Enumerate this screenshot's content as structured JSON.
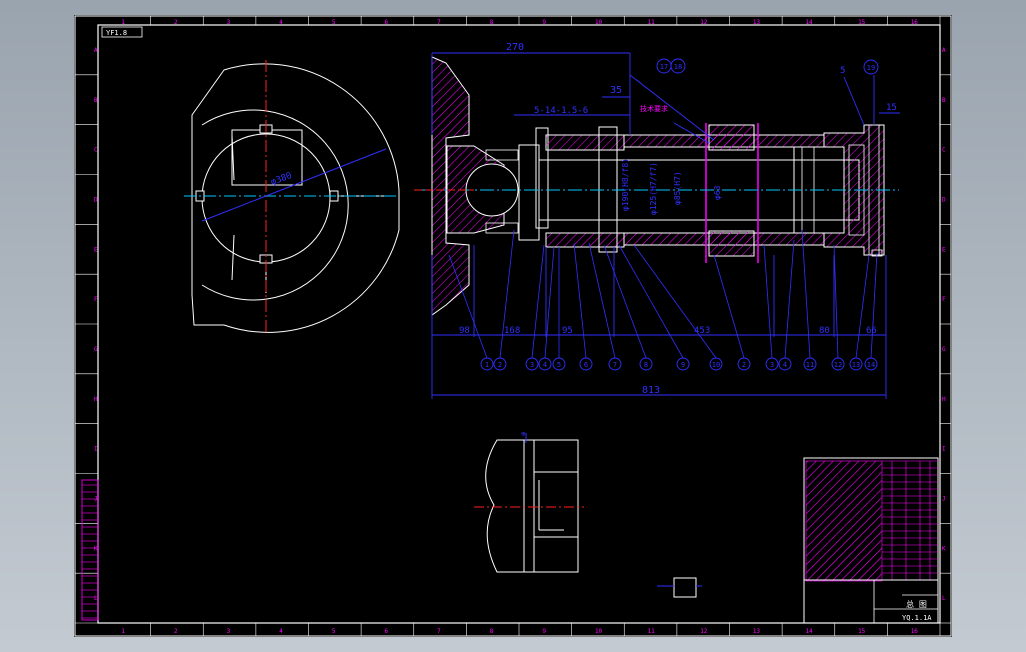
{
  "drawing": {
    "stamp": "YF1.8",
    "drawing_no": "YQ.1.1A",
    "part_title": "总 图",
    "column_labels": [
      "1",
      "2",
      "3",
      "4",
      "5",
      "6",
      "7",
      "8",
      "9",
      "10",
      "11",
      "12",
      "13",
      "14",
      "15",
      "16"
    ],
    "row_labels": [
      "A",
      "B",
      "C",
      "D",
      "E",
      "F",
      "G",
      "H",
      "I",
      "J",
      "K",
      "L"
    ],
    "dimensions": {
      "top_overall": "270",
      "top_step": "35",
      "thread_note": "5-14-1.5-6",
      "bore_circle": "φ380",
      "overall_length": "813",
      "seg_a": "98",
      "seg_b": "168",
      "seg_c": "95",
      "seg_d": "453",
      "seg_e": "80",
      "seg_f": "66",
      "side_right": "15",
      "side_label": "5",
      "dia_1": "φ190(H8/f8)",
      "dia_2": "φ125(H7/f7)",
      "dia_3": "φ85(H7)",
      "dia_4": "φ63"
    },
    "balloons": [
      "1",
      "2",
      "3",
      "4",
      "5",
      "6",
      "7",
      "8",
      "9",
      "10",
      "2",
      "3",
      "4",
      "11",
      "12",
      "13",
      "14"
    ],
    "top_balloons": [
      "17",
      "18",
      "19"
    ],
    "annotation": "技术要求"
  },
  "colors": {
    "background": "#000000",
    "frame": "#ffffff",
    "dimension": "#3030ff",
    "hatch": "#ff00ff",
    "centerline": "#ff2020",
    "axis": "#00c8ff",
    "title_block": "#ff00ff"
  }
}
